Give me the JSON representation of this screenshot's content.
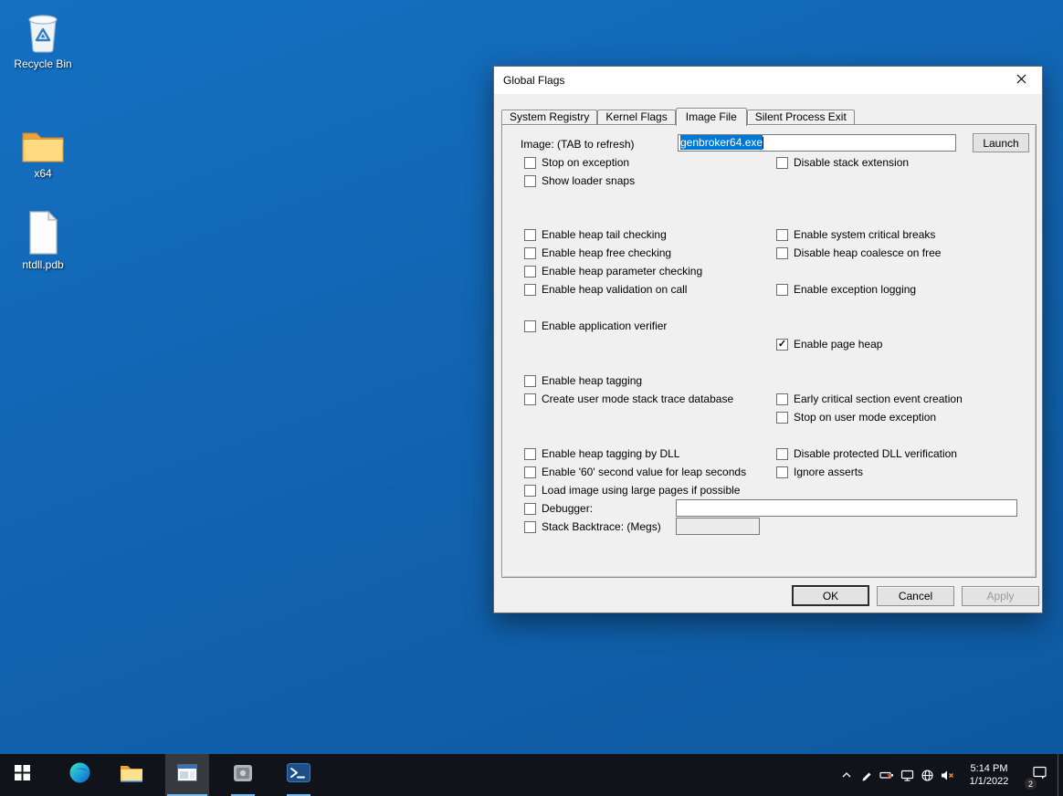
{
  "desktop": {
    "icons": [
      {
        "name": "recycle-bin",
        "label": "Recycle Bin"
      },
      {
        "name": "x64-folder",
        "label": "x64"
      },
      {
        "name": "ntdll-pdb-file",
        "label": "ntdll.pdb"
      }
    ]
  },
  "dialog": {
    "title": "Global Flags",
    "tabs": [
      {
        "label": "System Registry",
        "active": false
      },
      {
        "label": "Kernel Flags",
        "active": false
      },
      {
        "label": "Image File",
        "active": true
      },
      {
        "label": "Silent Process Exit",
        "active": false
      }
    ],
    "image_row": {
      "label": "Image: (TAB to refresh)",
      "value": "genbroker64.exe",
      "launch_label": "Launch"
    },
    "checkboxes_left": [
      {
        "label": "Stop on exception",
        "checked": false,
        "mark": ""
      },
      {
        "label": "Show loader snaps",
        "checked": false,
        "mark": ""
      },
      {
        "label": "Enable heap tail checking",
        "checked": false,
        "mark": ""
      },
      {
        "label": "Enable heap free checking",
        "checked": false,
        "mark": ""
      },
      {
        "label": "Enable heap parameter checking",
        "checked": false,
        "mark": ""
      },
      {
        "label": "Enable heap validation on call",
        "checked": false,
        "mark": ""
      },
      {
        "label": "Enable application verifier",
        "checked": false,
        "mark": ""
      },
      {
        "label": "Enable heap tagging",
        "checked": false,
        "mark": ""
      },
      {
        "label": "Create user mode stack trace database",
        "checked": false,
        "mark": ""
      },
      {
        "label": "Enable heap tagging by DLL",
        "checked": false,
        "mark": ""
      },
      {
        "label": "Enable '60' second value for leap seconds",
        "checked": false,
        "mark": ""
      },
      {
        "label": "Load image using large pages if possible",
        "checked": false,
        "mark": ""
      },
      {
        "label": "Debugger:",
        "checked": false,
        "mark": "",
        "value": ""
      },
      {
        "label": "Stack Backtrace: (Megs)",
        "checked": false,
        "mark": "",
        "value": ""
      }
    ],
    "checkboxes_right": [
      {
        "label": "Disable stack extension",
        "checked": false,
        "mark": ""
      },
      {
        "label": "Enable system critical breaks",
        "checked": false,
        "mark": ""
      },
      {
        "label": "Disable heap coalesce on free",
        "checked": false,
        "mark": ""
      },
      {
        "label": "Enable exception logging",
        "checked": false,
        "mark": ""
      },
      {
        "label": "Enable page heap",
        "checked": true,
        "mark": "✓"
      },
      {
        "label": "Early critical section event creation",
        "checked": false,
        "mark": ""
      },
      {
        "label": "Stop on user mode exception",
        "checked": false,
        "mark": ""
      },
      {
        "label": "Disable protected DLL verification",
        "checked": false,
        "mark": ""
      },
      {
        "label": "Ignore asserts",
        "checked": false,
        "mark": ""
      }
    ],
    "buttons": {
      "ok": "OK",
      "cancel": "Cancel",
      "apply": "Apply"
    }
  },
  "taskbar": {
    "tray": {
      "time": "5:14 PM",
      "date": "1/1/2022",
      "notification_count": "2"
    }
  },
  "colors": {
    "desktop_blue": "#1162ae",
    "selection_blue": "#0078d7",
    "taskbar_black": "#10141a"
  }
}
